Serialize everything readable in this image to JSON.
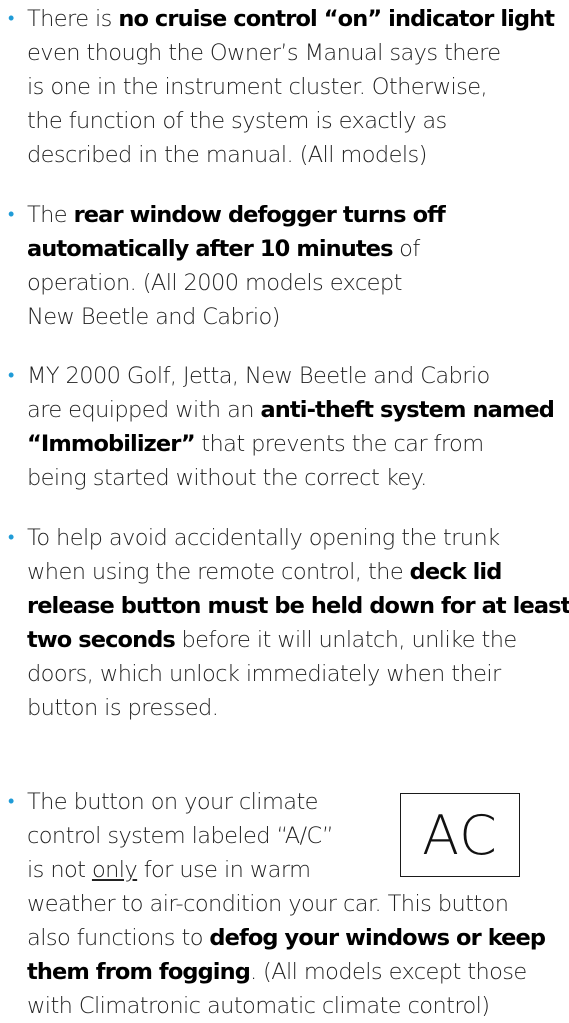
{
  "bullet_glyph": "•",
  "items": [
    {
      "lines": [
        [
          {
            "t": "There is "
          },
          {
            "t": "no cruise control “on” indicator light",
            "b": true
          }
        ],
        [
          {
            "t": "even though the Owner’s Manual says there"
          }
        ],
        [
          {
            "t": "is one in the instrument cluster.  Otherwise,"
          }
        ],
        [
          {
            "t": "the function of the system is exactly as"
          }
        ],
        [
          {
            "t": "described in the manual. (All models)"
          }
        ]
      ]
    },
    {
      "lines": [
        [
          {
            "t": "The "
          },
          {
            "t": "rear window defogger turns off",
            "b": true
          }
        ],
        [
          {
            "t": "automatically after 10 minutes",
            "b": true
          },
          {
            "t": " of"
          }
        ],
        [
          {
            "t": "operation. (All 2000 models except"
          }
        ],
        [
          {
            "t": "New Beetle and Cabrio)"
          }
        ]
      ]
    },
    {
      "lines": [
        [
          {
            "t": "MY 2000 Golf, Jetta, New Beetle and Cabrio"
          }
        ],
        [
          {
            "t": "are equipped with an "
          },
          {
            "t": "anti-theft system named",
            "b": true
          }
        ],
        [
          {
            "t": "“Immobilizer”",
            "b": true
          },
          {
            "t": " that prevents the car from"
          }
        ],
        [
          {
            "t": "being started without the correct key."
          }
        ]
      ]
    },
    {
      "lines": [
        [
          {
            "t": "To help avoid accidentally opening the trunk"
          }
        ],
        [
          {
            "t": "when using the remote control, the "
          },
          {
            "t": "deck lid",
            "b": true
          }
        ],
        [
          {
            "t": "release button must be held down for at least",
            "b": true
          }
        ],
        [
          {
            "t": "two seconds",
            "b": true
          },
          {
            "t": " before it will unlatch, unlike the"
          }
        ],
        [
          {
            "t": "doors, which unlock immediately when their"
          }
        ],
        [
          {
            "t": "button is pressed."
          }
        ]
      ]
    },
    {
      "lines": [
        [
          {
            "t": "The button on your climate"
          }
        ],
        [
          {
            "t": "control system labeled “A/C”"
          }
        ],
        [
          {
            "t": "is not "
          },
          {
            "t": "only",
            "u": true
          },
          {
            "t": " for use in warm"
          }
        ],
        [
          {
            "t": "weather to air-condition your car.  This button"
          }
        ],
        [
          {
            "t": "also functions to "
          },
          {
            "t": "defog your windows or keep",
            "b": true
          }
        ],
        [
          {
            "t": "them from fogging",
            "b": true
          },
          {
            "t": ". (All models except those"
          }
        ],
        [
          {
            "t": "with Climatronic automatic climate control)"
          }
        ]
      ]
    }
  ],
  "ac_button_label": "AC",
  "colors": {
    "bullet": "#1f9bd7",
    "text": "#222222",
    "bold_text": "#000000"
  }
}
